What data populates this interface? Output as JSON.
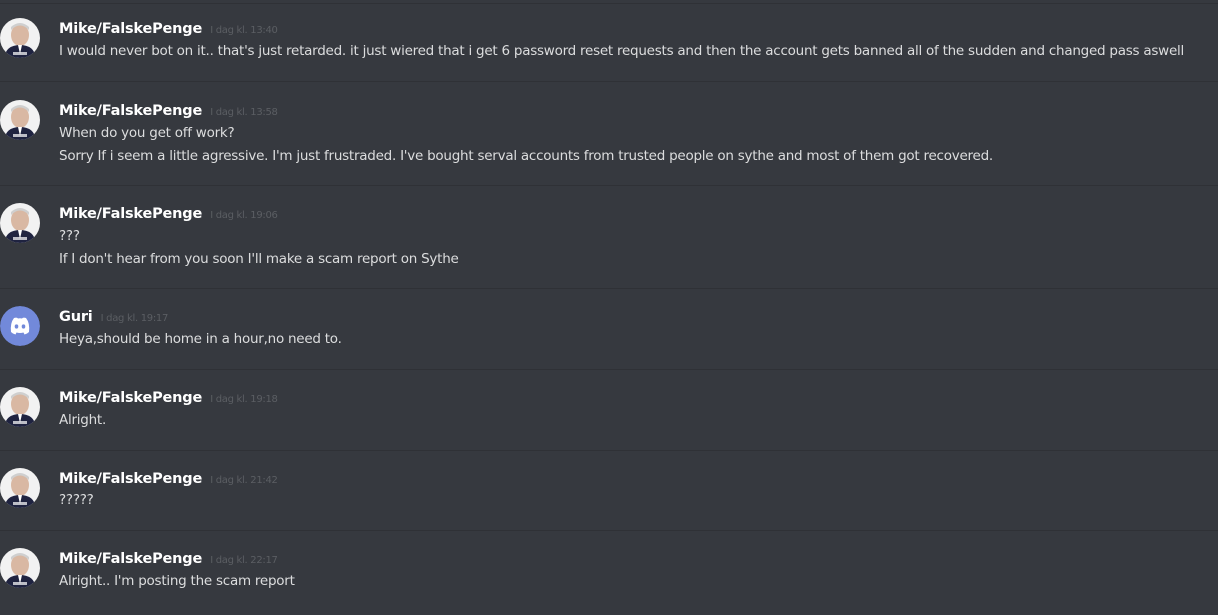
{
  "colors": {
    "background": "#36393f",
    "divider": "#2f3136",
    "username": "#ffffff",
    "text": "#dcddde",
    "timestamp": "#5b5e63",
    "discord_blurple": "#7289da"
  },
  "messages": [
    {
      "author": "Mike/FalskePenge",
      "avatar": "mike-photo-avatar",
      "timestamp": "I dag kl. 13:40",
      "lines": [
        "I would never bot on it.. that's just retarded. it just wiered that i get 6 password reset requests and then the account gets banned all of the sudden and changed pass aswell"
      ]
    },
    {
      "author": "Mike/FalskePenge",
      "avatar": "mike-photo-avatar",
      "timestamp": "I dag kl. 13:58",
      "lines": [
        "When do you get off work?",
        "Sorry If i seem a little agressive. I'm just frustraded. I've bought serval accounts from trusted people on sythe and most of them got recovered."
      ]
    },
    {
      "author": "Mike/FalskePenge",
      "avatar": "mike-photo-avatar",
      "timestamp": "I dag kl. 19:06",
      "lines": [
        "???",
        "If I don't hear from you soon I'll make a scam report on Sythe"
      ]
    },
    {
      "author": "Guri",
      "avatar": "discord-default-avatar",
      "timestamp": "I dag kl. 19:17",
      "lines": [
        "Heya,should be home in a hour,no need to."
      ]
    },
    {
      "author": "Mike/FalskePenge",
      "avatar": "mike-photo-avatar",
      "timestamp": "I dag kl. 19:18",
      "lines": [
        "Alright."
      ]
    },
    {
      "author": "Mike/FalskePenge",
      "avatar": "mike-photo-avatar",
      "timestamp": "I dag kl. 21:42",
      "lines": [
        "?????"
      ]
    },
    {
      "author": "Mike/FalskePenge",
      "avatar": "mike-photo-avatar",
      "timestamp": "I dag kl. 22:17",
      "lines": [
        "Alright.. I'm posting the scam report"
      ]
    }
  ]
}
